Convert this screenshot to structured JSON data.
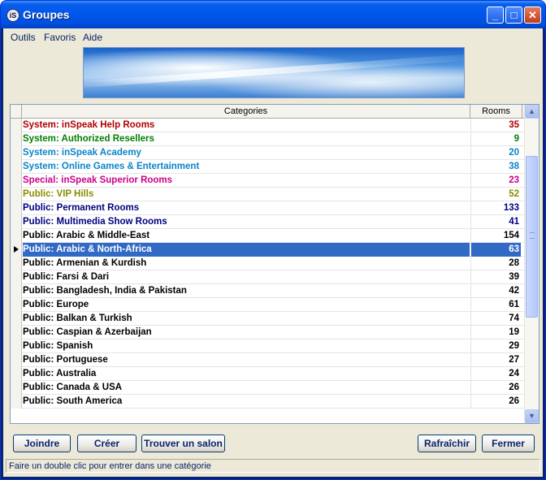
{
  "window": {
    "title": "Groupes",
    "app_icon_text": "iS",
    "controls": {
      "minimize": "_",
      "maximize": "□",
      "close": "✕"
    }
  },
  "menu": {
    "items": [
      "Outils",
      "Favoris",
      "Aide"
    ]
  },
  "grid": {
    "columns": {
      "category": "Categories",
      "rooms": "Rooms"
    },
    "rows": [
      {
        "name": "System: inSpeak Help Rooms",
        "rooms": "35",
        "color": "#b00000"
      },
      {
        "name": "System: Authorized Resellers",
        "rooms": "9",
        "color": "#008000"
      },
      {
        "name": "System: inSpeak Academy",
        "rooms": "20",
        "color": "#0a84c8"
      },
      {
        "name": "System: Online Games & Entertainment",
        "rooms": "38",
        "color": "#0a84c8"
      },
      {
        "name": "Special: inSpeak Superior Rooms",
        "rooms": "23",
        "color": "#cc0088"
      },
      {
        "name": "Public: VIP Hills",
        "rooms": "52",
        "color": "#8c8c00"
      },
      {
        "name": "Public: Permanent Rooms",
        "rooms": "133",
        "color": "#000080"
      },
      {
        "name": "Public: Multimedia Show Rooms",
        "rooms": "41",
        "color": "#000080"
      },
      {
        "name": "Public: Arabic & Middle-East",
        "rooms": "154",
        "color": "#000000"
      },
      {
        "name": "Public: Arabic & North-Africa",
        "rooms": "63",
        "color": "#000000"
      },
      {
        "name": "Public: Armenian & Kurdish",
        "rooms": "28",
        "color": "#000000"
      },
      {
        "name": "Public: Farsi & Dari",
        "rooms": "39",
        "color": "#000000"
      },
      {
        "name": "Public: Bangladesh, India & Pakistan",
        "rooms": "42",
        "color": "#000000"
      },
      {
        "name": "Public: Europe",
        "rooms": "61",
        "color": "#000000"
      },
      {
        "name": "Public: Balkan & Turkish",
        "rooms": "74",
        "color": "#000000"
      },
      {
        "name": "Public: Caspian & Azerbaijan",
        "rooms": "19",
        "color": "#000000"
      },
      {
        "name": "Public: Spanish",
        "rooms": "29",
        "color": "#000000"
      },
      {
        "name": "Public: Portuguese",
        "rooms": "27",
        "color": "#000000"
      },
      {
        "name": "Public: Australia",
        "rooms": "24",
        "color": "#000000"
      },
      {
        "name": "Public: Canada & USA",
        "rooms": "26",
        "color": "#000000"
      },
      {
        "name": "Public: South America",
        "rooms": "26",
        "color": "#000000"
      }
    ],
    "selected_index": 9
  },
  "buttons": {
    "join": "Joindre",
    "create": "Créer",
    "find": "Trouver un salon",
    "refresh": "Rafraîchir",
    "close": "Fermer"
  },
  "status": {
    "text": "Faire un double clic pour entrer dans une catégorie"
  },
  "icons": {
    "up": "scroll-up-arrow-icon",
    "down": "scroll-down-arrow-icon"
  }
}
